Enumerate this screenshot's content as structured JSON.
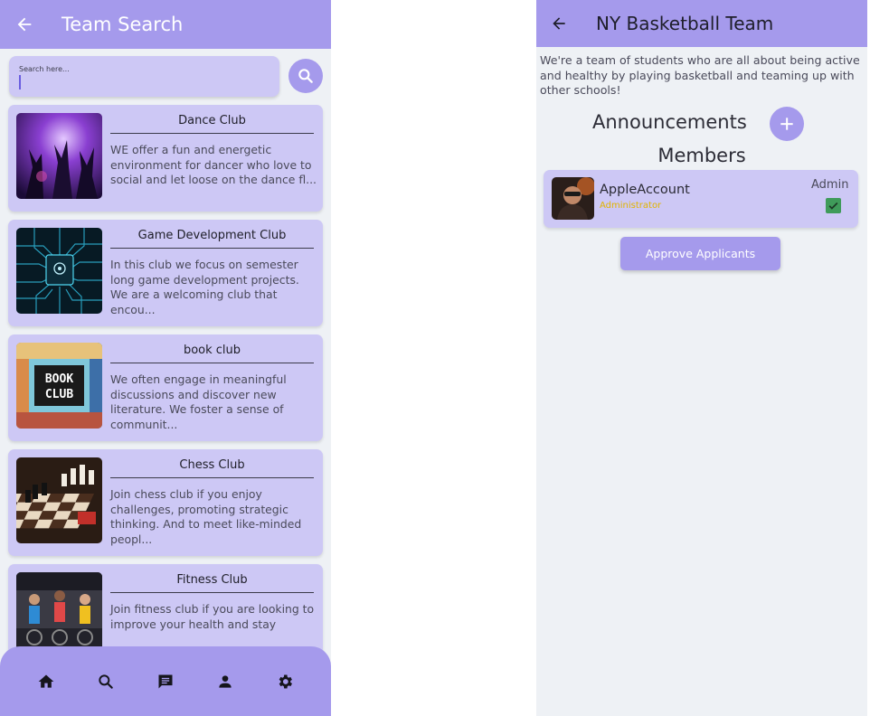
{
  "colors": {
    "primary": "#a59aec",
    "card": "#cdc8f5",
    "background": "#eef1f5",
    "role_text": "#e1b400",
    "check": "#3f9b5a"
  },
  "search_screen": {
    "title": "Team Search",
    "back_icon": "arrow-left-icon",
    "search": {
      "placeholder": "Search here...",
      "button_icon": "search-icon"
    },
    "teams": [
      {
        "name": "Dance Club",
        "description": "WE offer a fun and energetic environment for dancer who love to social and let loose on the dance fl...",
        "image": "dance-club-photo"
      },
      {
        "name": "Game Development Club",
        "description": "In this club we focus on semester long game development projects. We are a welcoming club that encou...",
        "image": "circuit-board-photo"
      },
      {
        "name": "book club",
        "description": "We often engage in meaningful discussions and discover new literature. We foster a sense of communit...",
        "image": "book-club-photo",
        "image_text_1": "BOOK",
        "image_text_2": "CLUB"
      },
      {
        "name": "Chess Club",
        "description": "Join chess club if you enjoy challenges, promoting strategic thinking. And to meet like-minded peopl...",
        "image": "chess-board-photo"
      },
      {
        "name": "Fitness Club",
        "description": "Join fitness club if you are looking to improve your health and stay",
        "image": "cycling-class-photo"
      }
    ],
    "nav": [
      "home-icon",
      "search-icon",
      "chat-icon",
      "person-icon",
      "gear-icon"
    ]
  },
  "team_screen": {
    "title": "NY Basketball Team",
    "back_icon": "arrow-left-icon",
    "description": "We're a team of students who are all about being active and healthy by playing basketball and teaming up with other schools!",
    "announcements_label": "Announcements",
    "add_icon": "plus-icon",
    "members_label": "Members",
    "members": [
      {
        "name": "AppleAccount",
        "role": "Administrator",
        "admin_label": "Admin",
        "is_admin": true
      }
    ],
    "approve_label": "Approve Applicants"
  }
}
